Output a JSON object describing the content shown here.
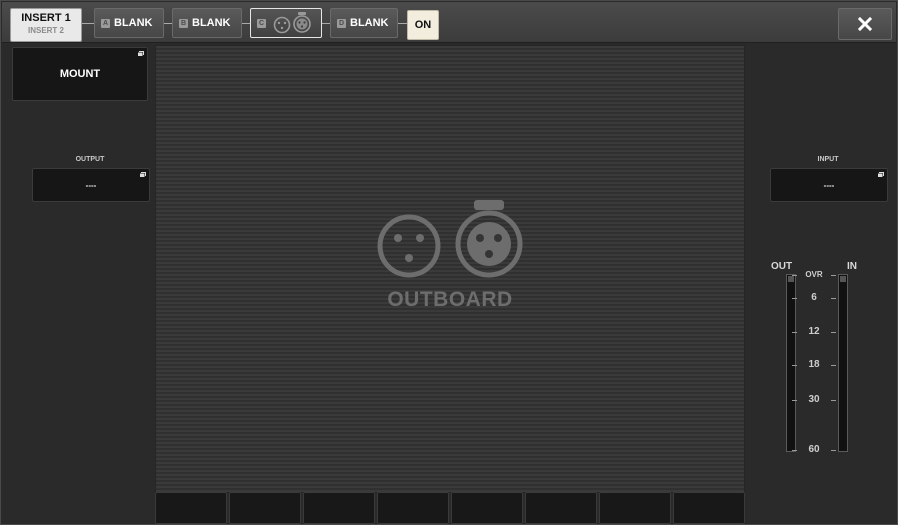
{
  "header": {
    "insert_primary": "INSERT 1",
    "insert_secondary": "INSERT 2",
    "slots": [
      {
        "letter": "A",
        "label": "BLANK"
      },
      {
        "letter": "B",
        "label": "BLANK"
      },
      {
        "letter": "C",
        "label": ""
      },
      {
        "letter": "D",
        "label": "BLANK"
      }
    ],
    "on_label": "ON",
    "close_icon": "close-icon"
  },
  "left": {
    "mount_label": "MOUNT",
    "output_label": "OUTPUT",
    "output_value": "----"
  },
  "center": {
    "title": "OUTBOARD",
    "icon": "xlr-connectors-icon"
  },
  "right": {
    "input_label": "INPUT",
    "input_value": "----"
  },
  "meter": {
    "out_label": "OUT",
    "in_label": "IN",
    "scale": [
      "OVR",
      "6",
      "12",
      "18",
      "30",
      "60"
    ]
  },
  "colors": {
    "on_button": "#f2eddd",
    "panel": "#2a2a2a"
  }
}
